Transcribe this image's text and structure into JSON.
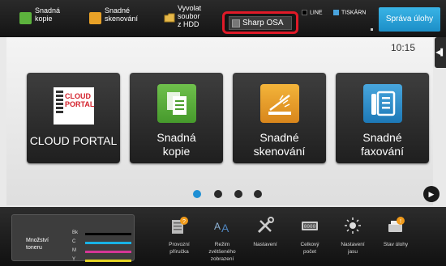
{
  "topbar": {
    "shortcuts": [
      {
        "label": "Snadná\nkopie",
        "icon": "copy-icon",
        "color": "#5cb23d"
      },
      {
        "label": "Snadné\nskenování",
        "icon": "scan-icon",
        "color": "#e8a127"
      },
      {
        "label": "Vyvolat\nsoubor\nz HDD",
        "icon": "folder-icon"
      }
    ],
    "osa_label": "Sharp OSA",
    "status": {
      "line": "LINE",
      "printer": "TISKÁRN"
    },
    "job_button": "Správa úlohy"
  },
  "main": {
    "clock": "10:15",
    "tiles": [
      {
        "label": "CLOUD PORTAL",
        "logo_text": "CLOUD\nPORTAL"
      },
      {
        "label": "Snadná\nkopie",
        "icon": "copy-icon",
        "color": "#5cb23d"
      },
      {
        "label": "Snadné\nskenování",
        "icon": "scan-icon",
        "color": "#e8a127"
      },
      {
        "label": "Snadné\nfaxování",
        "icon": "fax-icon",
        "color": "#2b8fcf"
      }
    ],
    "pagination": {
      "pages": 4,
      "current": 1
    }
  },
  "bottombar": {
    "toner": {
      "title": "Množství\ntoneru",
      "rows": [
        {
          "label": "Bk",
          "color": "#000000"
        },
        {
          "label": "C",
          "color": "#19b1e5"
        },
        {
          "label": "M",
          "color": "#d43695"
        },
        {
          "label": "Y",
          "color": "#e6d424"
        }
      ]
    },
    "items": [
      {
        "label": "Provozní\npříručka",
        "icon": "manual-icon"
      },
      {
        "label": "Režim\nzvětšeného\nzobrazení",
        "icon": "zoom-view-icon"
      },
      {
        "label": "Nastavení",
        "icon": "tools-icon"
      },
      {
        "label": "Celkový\npočet",
        "icon": "counter-icon"
      },
      {
        "label": "Nastavení\njasu",
        "icon": "brightness-icon"
      },
      {
        "label": "Stav úlohy",
        "icon": "job-status-icon"
      }
    ]
  }
}
